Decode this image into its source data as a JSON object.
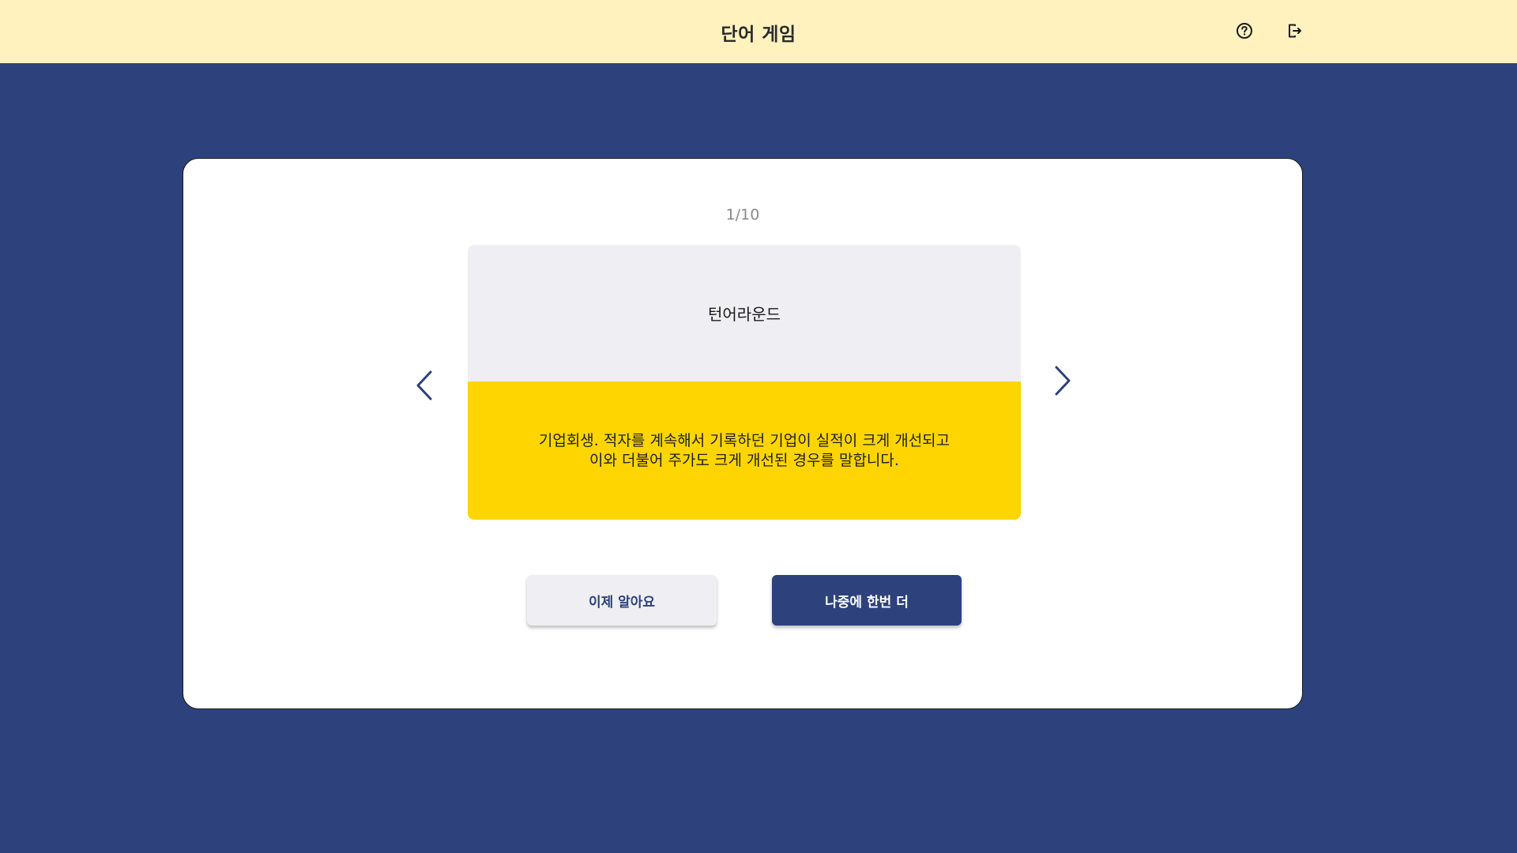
{
  "header": {
    "title": "단어 게임",
    "help_icon": "question-circle-icon",
    "logout_icon": "logout-icon"
  },
  "game": {
    "counter": "1/10",
    "card": {
      "term": "턴어라운드",
      "definition": "기업회생. 적자를 계속해서 기록하던 기업이 실적이 크게 개선되고\n이와 더불어 주가도 크게 개선된 경우를 말합니다."
    },
    "buttons": {
      "know_label": "이제 알아요",
      "later_label": "나중에 한번 더"
    }
  },
  "colors": {
    "header_bg": "#fff2bf",
    "page_bg": "#2d427c",
    "card_front_bg": "#efeff3",
    "card_back_bg": "#ffd500",
    "primary": "#2d427c"
  }
}
